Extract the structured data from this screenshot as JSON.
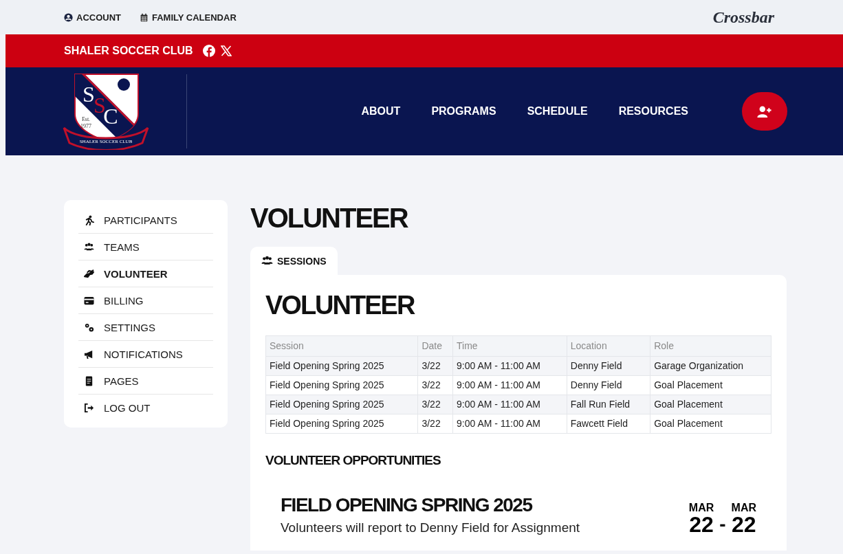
{
  "top_links": [
    {
      "label": "ACCOUNT"
    },
    {
      "label": "FAMILY CALENDAR"
    }
  ],
  "brand_logo": "Crossbar",
  "club_name": "SHALER SOCCER CLUB",
  "crest": {
    "letters": [
      "S",
      "S",
      "C"
    ],
    "est": "Est.",
    "year": "1977",
    "ribbon": "SHALER SOCCER CLUB"
  },
  "nav": [
    "ABOUT",
    "PROGRAMS",
    "SCHEDULE",
    "RESOURCES"
  ],
  "sidebar": {
    "items": [
      {
        "label": "PARTICIPANTS",
        "selected": false
      },
      {
        "label": "TEAMS",
        "selected": false
      },
      {
        "label": "VOLUNTEER",
        "selected": true
      },
      {
        "label": "BILLING",
        "selected": false
      },
      {
        "label": "SETTINGS",
        "selected": false
      },
      {
        "label": "NOTIFICATIONS",
        "selected": false
      },
      {
        "label": "PAGES",
        "selected": false
      },
      {
        "label": "LOG OUT",
        "selected": false
      }
    ]
  },
  "page_title": "VOLUNTEER",
  "tabs": [
    {
      "label": "SESSIONS",
      "selected": true
    }
  ],
  "panel": {
    "heading": "VOLUNTEER",
    "table": {
      "columns": [
        "Session",
        "Date",
        "Time",
        "Location",
        "Role"
      ],
      "rows": [
        [
          "Field Opening Spring 2025",
          "3/22",
          "9:00 AM - 11:00 AM",
          "Denny Field",
          "Garage Organization"
        ],
        [
          "Field Opening Spring 2025",
          "3/22",
          "9:00 AM - 11:00 AM",
          "Denny Field",
          "Goal Placement"
        ],
        [
          "Field Opening Spring 2025",
          "3/22",
          "9:00 AM - 11:00 AM",
          "Fall Run Field",
          "Goal Placement"
        ],
        [
          "Field Opening Spring 2025",
          "3/22",
          "9:00 AM - 11:00 AM",
          "Fawcett Field",
          "Goal Placement"
        ]
      ]
    },
    "section_title": "VOLUNTEER OPPORTUNITIES",
    "opportunities": [
      {
        "title": "FIELD OPENING SPRING 2025",
        "description": "Volunteers will report to Denny Field for Assignment",
        "start_month": "MAR",
        "start_day": "22",
        "separator": "-",
        "end_month": "MAR",
        "end_day": "22"
      }
    ]
  }
}
